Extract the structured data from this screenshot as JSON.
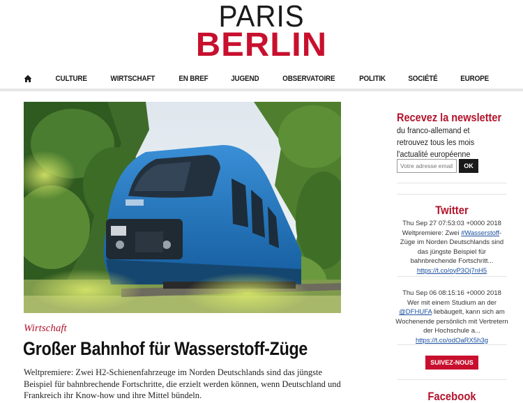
{
  "logo": {
    "line1": "PARIS",
    "line2": "BERLIN"
  },
  "nav": {
    "items": [
      "CULTURE",
      "WIRTSCHAFT",
      "EN BREF",
      "JUGEND",
      "OBSERVATOIRE",
      "POLITIK",
      "SOCIÉTÉ",
      "EUROPE"
    ]
  },
  "article": {
    "category": "Wirtschaft",
    "headline": "Großer Bahnhof für Wasserstoff-Züge",
    "excerpt": "Weltpremiere: Zwei H2-Schienenfahrzeuge im Norden Deutschlands sind das jüngste Beispiel für bahnbrechende Fortschritte, die erzielt werden können, wenn Deutschland und Frankreich ihr Know-how und ihre Mittel bündeln."
  },
  "newsletter": {
    "title": "Recevez la newsletter",
    "text": "du franco-allemand et retrouvez tous les mois l'actualité européenne",
    "input_placeholder": "Votre adresse email",
    "button": "OK"
  },
  "twitter": {
    "title": "Twitter",
    "tweets": [
      {
        "date": "Thu Sep 27 07:53:03 +0000 2018",
        "pre": "Weltpremiere: Zwei ",
        "tag": "#Wasserstoff",
        "post": "-Züge im Norden Deutschlands sind das jüngste Beispiel für bahnbrechende Fortschritt...",
        "link": "https://t.co/oyP3Oj7nH5"
      },
      {
        "date": "Thu Sep 06 08:15:16 +0000 2018",
        "pre": "Wer mit einem Studium an der ",
        "tag": "@DFHUFA",
        "post": " liebäugelt, kann sich am Wochenende persönlich mit Vertretern der Hochschule a...",
        "link": "https://t.co/odOaRX5h3g"
      }
    ],
    "follow_button": "SUIVEZ-NOUS"
  },
  "facebook": {
    "title": "Facebook"
  },
  "colors": {
    "brand_red": "#c8102e",
    "accent_red": "#b3142c",
    "train_blue": "#1f6fb8"
  },
  "icons": {
    "home": "home-icon"
  }
}
